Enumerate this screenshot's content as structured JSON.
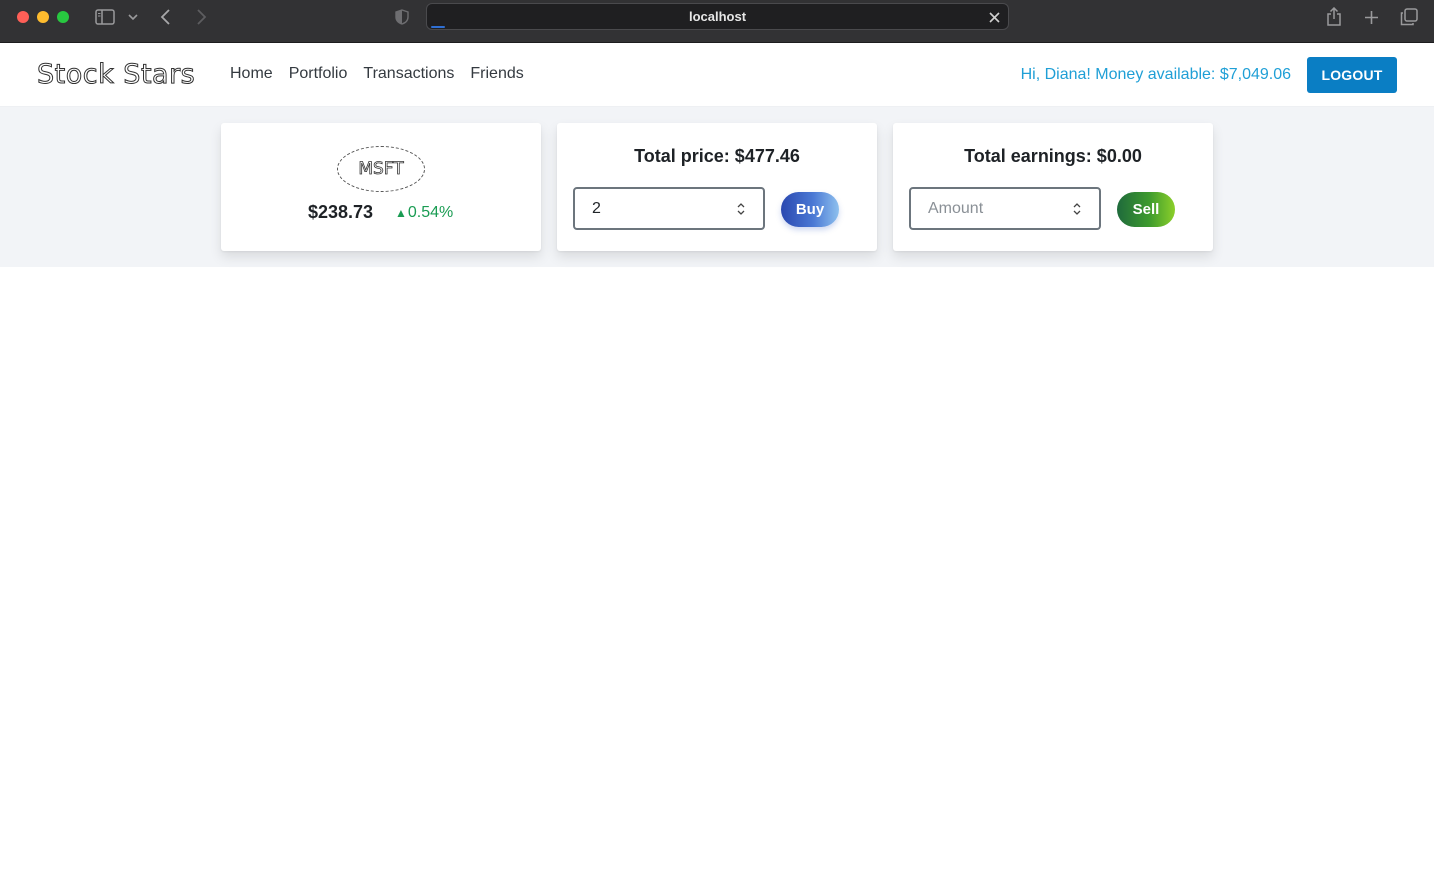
{
  "browser": {
    "url": "localhost",
    "icons": [
      "sidebar-icon",
      "chevron-down-icon",
      "back-icon",
      "forward-icon",
      "shield-icon",
      "close-icon",
      "share-icon",
      "plus-icon",
      "tabs-icon"
    ]
  },
  "navbar": {
    "brand": "Stock Stars",
    "links": [
      "Home",
      "Portfolio",
      "Transactions",
      "Friends"
    ],
    "greeting": "Hi, Diana! Money available: $7,049.06",
    "logout_label": "LOGOUT",
    "colors": {
      "greeting": "#1f9fd6",
      "logout_bg": "#0a7ec4"
    }
  },
  "stock": {
    "ticker": "MSFT",
    "price": "$238.73",
    "change": "0.54%",
    "change_direction_icon": "triangle-up-icon",
    "change_color": "#1a9c53"
  },
  "buy": {
    "title": "Total price: $477.46",
    "quantity": "2",
    "placeholder": "Amount",
    "button_label": "Buy"
  },
  "sell": {
    "title": "Total earnings: $0.00",
    "quantity": "",
    "placeholder": "Amount",
    "button_label": "Sell"
  }
}
